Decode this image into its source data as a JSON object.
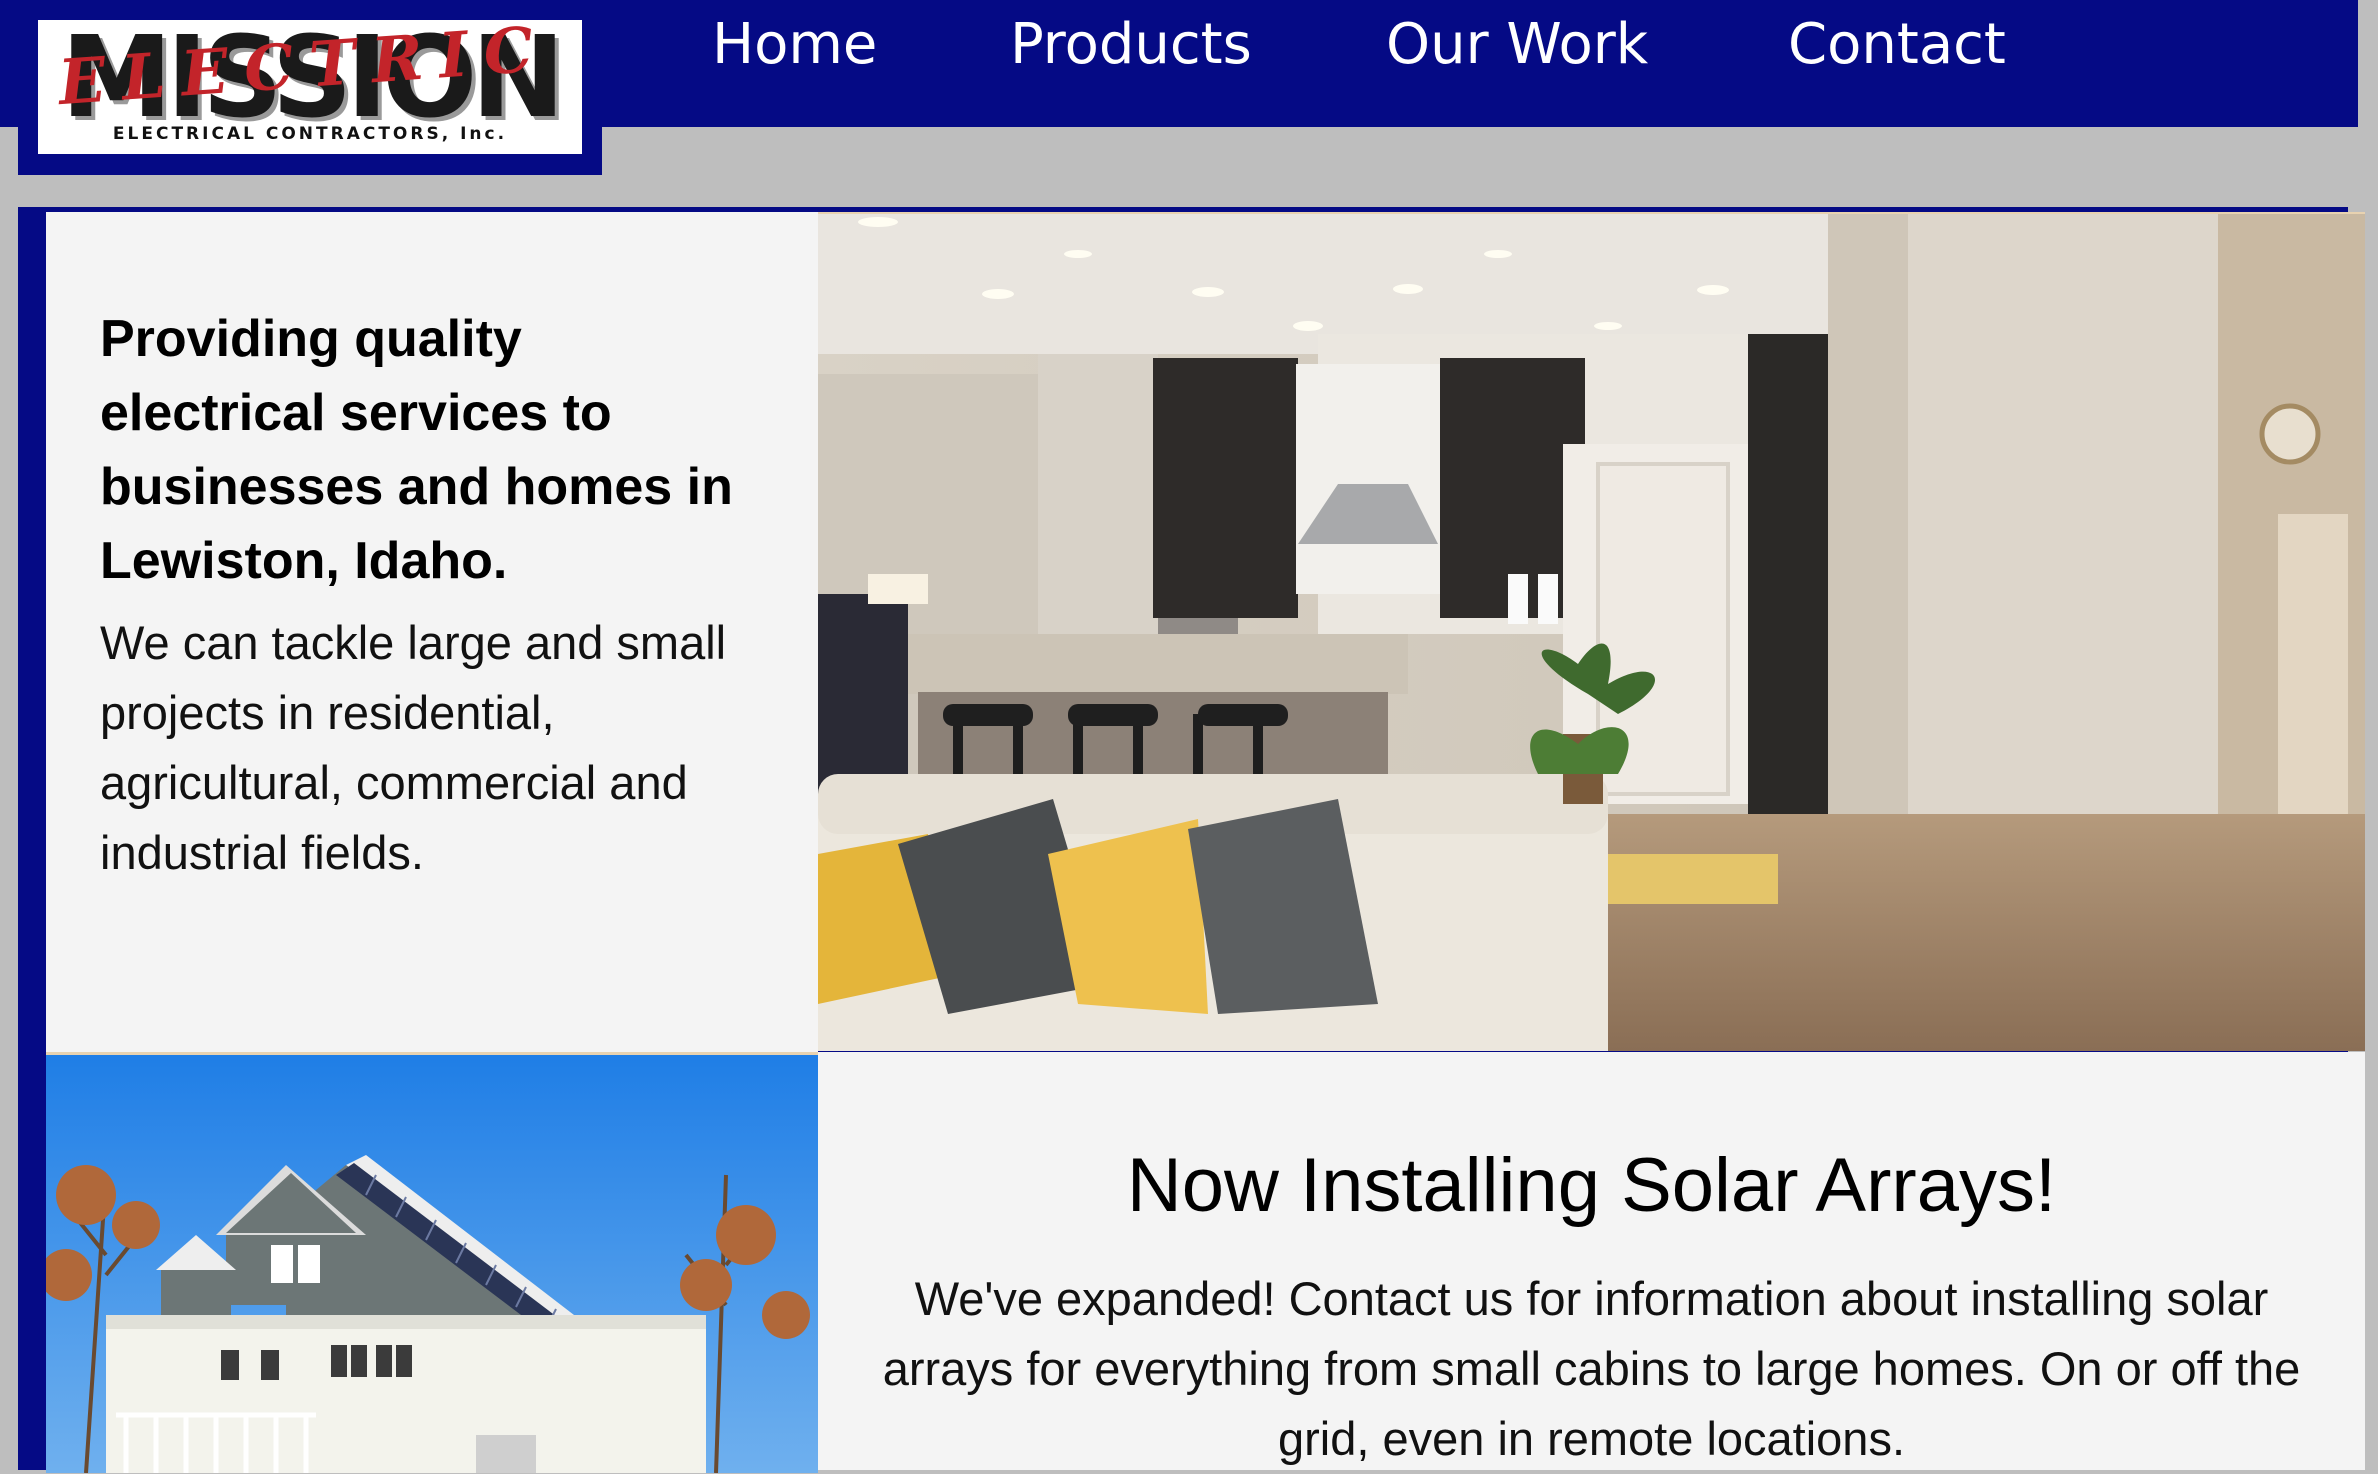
{
  "header": {
    "logo": {
      "word": "MISSION",
      "script": "ELECTRIC",
      "subtitle": "ELECTRICAL CONTRACTORS, Inc."
    },
    "nav": [
      {
        "label": "Home"
      },
      {
        "label": "Products"
      },
      {
        "label": "Our Work"
      },
      {
        "label": "Contact"
      }
    ]
  },
  "intro": {
    "heading": "Providing quality electrical services to businesses and homes in Lewiston, Idaho.",
    "body": "We can tackle large and small projects in residential, agricultural, commercial and industrial fields."
  },
  "solar": {
    "title": "Now Installing Solar Arrays!",
    "body": "We've expanded! Contact us for information about installing solar arrays for everything from small cabins to large homes. On or off the grid, even in remote locations."
  },
  "colors": {
    "nav_background": "#050a85",
    "page_background": "#bebebe",
    "panel_background": "#f4f4f4",
    "logo_red": "#c3242a"
  },
  "images": {
    "hero": "kitchen-living-room-photo",
    "solar": "house-with-solar-panels-photo"
  }
}
